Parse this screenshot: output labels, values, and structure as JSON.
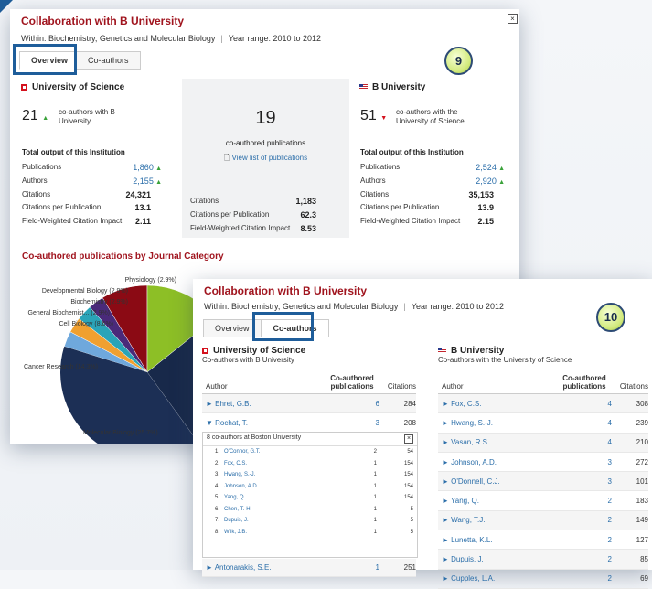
{
  "overview": {
    "title": "Collaboration with B University",
    "within": "Within: Biochemistry, Genetics and Molecular Biology",
    "year_range": "Year range: 2010 to 2012",
    "tabs": [
      "Overview",
      "Co-authors"
    ],
    "step_number": "9",
    "left": {
      "name": "University of Science",
      "coauthors": "21",
      "coauthors_text": "co-authors with B University",
      "total_output_label": "Total output of this Institution",
      "stats": [
        {
          "label": "Publications",
          "value": "1,860",
          "trend": "up"
        },
        {
          "label": "Authors",
          "value": "2,155",
          "trend": "up"
        },
        {
          "label": "Citations",
          "value": "24,321"
        },
        {
          "label": "Citations per Publication",
          "value": "13.1"
        },
        {
          "label": "Field-Weighted Citation Impact",
          "value": "2.11"
        }
      ]
    },
    "middle": {
      "count": "19",
      "label": "co-authored publications",
      "link": "View list of publications",
      "stats": [
        {
          "label": "Citations",
          "value": "1,183"
        },
        {
          "label": "Citations per Publication",
          "value": "62.3"
        },
        {
          "label": "Field-Weighted Citation Impact",
          "value": "8.53"
        }
      ]
    },
    "right": {
      "name": "B University",
      "coauthors": "51",
      "coauthors_text": "co-authors with the University of Science",
      "total_output_label": "Total output of this Institution",
      "stats": [
        {
          "label": "Publications",
          "value": "2,524",
          "trend": "up"
        },
        {
          "label": "Authors",
          "value": "2,920",
          "trend": "up"
        },
        {
          "label": "Citations",
          "value": "35,153"
        },
        {
          "label": "Citations per Publication",
          "value": "13.9"
        },
        {
          "label": "Field-Weighted Citation Impact",
          "value": "2.15"
        }
      ]
    },
    "journal_section_title": "Co-authored publications by Journal Category",
    "pie_labels": [
      "Physiology (2.9%)",
      "Developmental Biology (2.9%)",
      "Biochemistry (2.9%)",
      "General Biochemist... (2.9%)",
      "Cell Biology (8.6%)",
      "Cancer Research (14.3%)",
      "Molecular Biology (25.7%)"
    ]
  },
  "chart_data": {
    "type": "pie",
    "title": "Co-authored publications by Journal Category",
    "categories": [
      "Physiology",
      "Developmental Biology",
      "Biochemistry",
      "General Biochemist...",
      "Cell Biology",
      "Cancer Research",
      "Molecular Biology"
    ],
    "values": [
      2.9,
      2.9,
      2.9,
      2.9,
      8.6,
      14.3,
      25.7
    ],
    "colors": [
      "#6fa8dc",
      "#f0a030",
      "#2aa4b8",
      "#4a2a7a",
      "#8b0a14",
      "#8dbf26",
      "#18294a"
    ]
  },
  "coauthors": {
    "title": "Collaboration with B University",
    "within": "Within: Biochemistry, Genetics and Molecular Biology",
    "year_range": "Year range: 2010 to 2012",
    "tabs": [
      "Overview",
      "Co-authors"
    ],
    "step_number": "10",
    "left": {
      "name": "University of Science",
      "subtitle": "Co-authors with B University",
      "headers": {
        "author": "Author",
        "copubs": "Co-authored publications",
        "citations": "Citations"
      },
      "rows_top": [
        {
          "author": "Ehret, G.B.",
          "copubs": "6",
          "citations": "284",
          "state": "collapsed"
        },
        {
          "author": "Rochat, T.",
          "copubs": "3",
          "citations": "208",
          "state": "expanded"
        }
      ],
      "sub_header": "8 co-authors at Boston University",
      "sub_rows": [
        {
          "n": "1.",
          "author": "O'Connor, G.T.",
          "p": "2",
          "c": "54"
        },
        {
          "n": "2.",
          "author": "Fox, C.S.",
          "p": "1",
          "c": "154"
        },
        {
          "n": "3.",
          "author": "Hwang, S.-J.",
          "p": "1",
          "c": "154"
        },
        {
          "n": "4.",
          "author": "Johnson, A.D.",
          "p": "1",
          "c": "154"
        },
        {
          "n": "5.",
          "author": "Yang, Q.",
          "p": "1",
          "c": "154"
        },
        {
          "n": "6.",
          "author": "Chen, T.-H.",
          "p": "1",
          "c": "5"
        },
        {
          "n": "7.",
          "author": "Dupuis, J.",
          "p": "1",
          "c": "5"
        },
        {
          "n": "8.",
          "author": "Wilk, J.B.",
          "p": "1",
          "c": "5"
        }
      ],
      "row_bottom": {
        "author": "Antonarakis, S.E.",
        "copubs": "1",
        "citations": "251"
      }
    },
    "right": {
      "name": "B University",
      "subtitle": "Co-authors with the University of Science",
      "headers": {
        "author": "Author",
        "copubs": "Co-authored publications",
        "citations": "Citations"
      },
      "rows": [
        {
          "author": "Fox, C.S.",
          "copubs": "4",
          "citations": "308"
        },
        {
          "author": "Hwang, S.-J.",
          "copubs": "4",
          "citations": "239"
        },
        {
          "author": "Vasan, R.S.",
          "copubs": "4",
          "citations": "210"
        },
        {
          "author": "Johnson, A.D.",
          "copubs": "3",
          "citations": "272"
        },
        {
          "author": "O'Donnell, C.J.",
          "copubs": "3",
          "citations": "101"
        },
        {
          "author": "Yang, Q.",
          "copubs": "2",
          "citations": "183"
        },
        {
          "author": "Wang, T.J.",
          "copubs": "2",
          "citations": "149"
        },
        {
          "author": "Lunetta, K.L.",
          "copubs": "2",
          "citations": "127"
        },
        {
          "author": "Dupuis, J.",
          "copubs": "2",
          "citations": "85"
        },
        {
          "author": "Cupples, L.A.",
          "copubs": "2",
          "citations": "69"
        }
      ]
    }
  }
}
